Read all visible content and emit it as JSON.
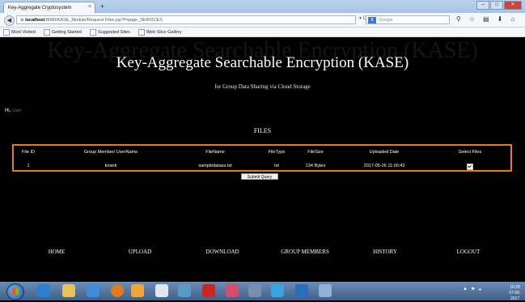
{
  "browser": {
    "tab_title": "Key-Aggregate Cryptosystem",
    "tab_close": "×",
    "new_tab": "+",
    "url_host": "localhost",
    "url_path": ":8080/KASE_Module/Request Files.jsp?f=page_SERVICES",
    "search_placeholder": "Google",
    "search_badge": "8",
    "bookmarks": [
      "Most Visited",
      "Getting Started",
      "Suggested Sites",
      "Web Slice Gallery"
    ]
  },
  "page": {
    "ghost_title": "Key-Aggregate Searchable Encryption (KASE)",
    "title": "Key-Aggregate Searchable Encryption (KASE)",
    "subtitle": "for Group Data Sharing via Cloud Storage",
    "greeting_prefix": "Hi,",
    "greeting_user": "user",
    "files_heading": "FILES",
    "table": {
      "headers": [
        "File ID",
        "Group Member/ UserName",
        "FileName",
        "FileType",
        "FileSize",
        "Uploaded Date",
        "Select Files"
      ],
      "rows": [
        [
          "1",
          "kiranti",
          "sampledatass.txt",
          "txt",
          "134 Bytes",
          "2017-05-26 11:00:43"
        ]
      ]
    },
    "submit_label": "Submit Query",
    "nav": [
      "HOME",
      "UPLOAD",
      "DOWNLOAD",
      "GROUP MEMBERS",
      "HISTORY",
      "LOGOUT"
    ]
  },
  "taskbar": {
    "clock_time": "16:28",
    "clock_date": "07-06-2017"
  },
  "colors": {
    "table_border": "#e67a1e",
    "page_bg": "#000000",
    "greeting_user": "#3a8a2a"
  }
}
